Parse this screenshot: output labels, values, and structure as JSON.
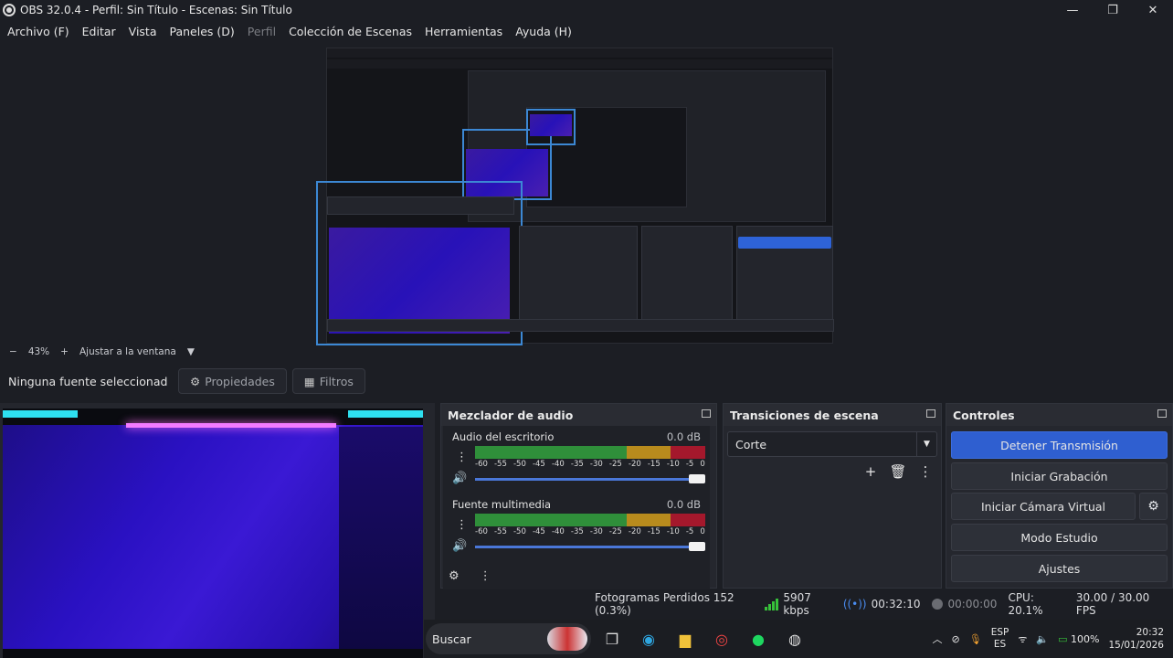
{
  "window": {
    "title": "OBS 32.0.4 - Perfil: Sin Título - Escenas: Sin Título",
    "minimize": "—",
    "maximize": "❐",
    "close": "✕"
  },
  "menu": [
    {
      "label": "Archivo (F)",
      "enabled": true
    },
    {
      "label": "Editar",
      "enabled": true
    },
    {
      "label": "Vista",
      "enabled": true
    },
    {
      "label": "Paneles (D)",
      "enabled": true
    },
    {
      "label": "Perfil",
      "enabled": false
    },
    {
      "label": "Colección de Escenas",
      "enabled": true
    },
    {
      "label": "Herramientas",
      "enabled": true
    },
    {
      "label": "Ayuda (H)",
      "enabled": true
    }
  ],
  "zoom": {
    "minus": "−",
    "value": "43%",
    "plus": "+",
    "fit": "Ajustar a la ventana",
    "dropdown": "▼"
  },
  "sourcebar": {
    "no_source": "Ninguna fuente seleccionad",
    "properties": "Propiedades",
    "filters": "Filtros"
  },
  "mixer": {
    "title": "Mezclador de audio",
    "channels": [
      {
        "name": "Audio del escritorio",
        "db": "0.0 dB",
        "level": 1.0
      },
      {
        "name": "Fuente multimedia",
        "db": "0.0 dB",
        "level": 1.0
      }
    ],
    "scale": [
      "-60",
      "-55",
      "-50",
      "-45",
      "-40",
      "-35",
      "-30",
      "-25",
      "-20",
      "-15",
      "-10",
      "-5",
      "0"
    ]
  },
  "transitions": {
    "title": "Transiciones de escena",
    "selected": "Corte"
  },
  "controls": {
    "title": "Controles",
    "stop_stream": "Detener Transmisión",
    "start_recording": "Iniciar Grabación",
    "start_virtual_cam": "Iniciar Cámara Virtual",
    "studio_mode": "Modo Estudio",
    "settings": "Ajustes"
  },
  "status": {
    "dropped_frames": "Fotogramas Perdidos 152 (0.3%)",
    "bitrate": "5907 kbps",
    "stream_time": "00:32:10",
    "rec_time": "00:00:00",
    "cpu": "CPU: 20.1%",
    "fps": "30.00 / 30.00 FPS"
  },
  "taskbar": {
    "search": "Buscar",
    "lang_line1": "ESP",
    "lang_line2": "ES",
    "battery": "100%",
    "time": "20:32",
    "date": "15/01/2026"
  },
  "colors": {
    "accent": "#2f5fd0",
    "meter_green": "#2f8f3a",
    "meter_yellow": "#b88b1d",
    "meter_red": "#a4182c",
    "cyan": "#2ee0f0",
    "pink": "#f37bff"
  }
}
